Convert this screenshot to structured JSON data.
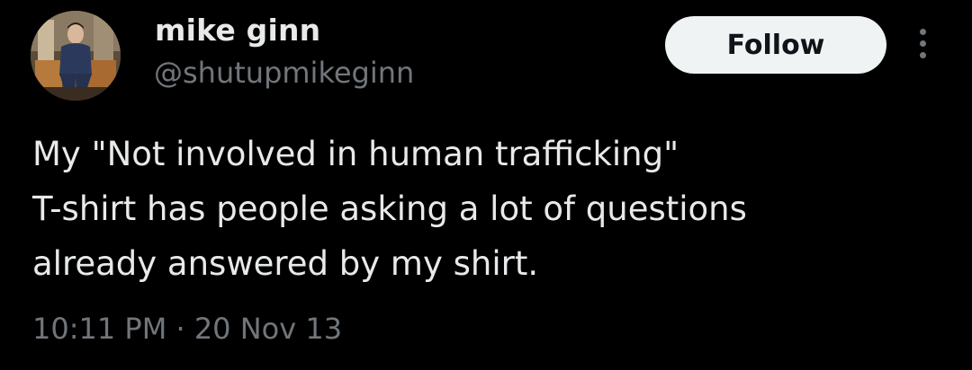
{
  "author": {
    "display_name": "mike ginn",
    "handle": "@shutupmikeginn"
  },
  "follow_label": "Follow",
  "more_icon": "more-vertical-icon",
  "tweet": {
    "lines": [
      "My \"Not involved in human trafficking\"",
      "T-shirt has people asking a lot of questions",
      "already answered by my shirt."
    ],
    "time": "10:11 PM",
    "separator": "·",
    "date": "20 Nov 13"
  },
  "colors": {
    "background": "#000000",
    "text_primary": "#e7e9ea",
    "text_secondary": "#71767b",
    "follow_bg": "#eff3f4",
    "follow_text": "#0f1419"
  }
}
